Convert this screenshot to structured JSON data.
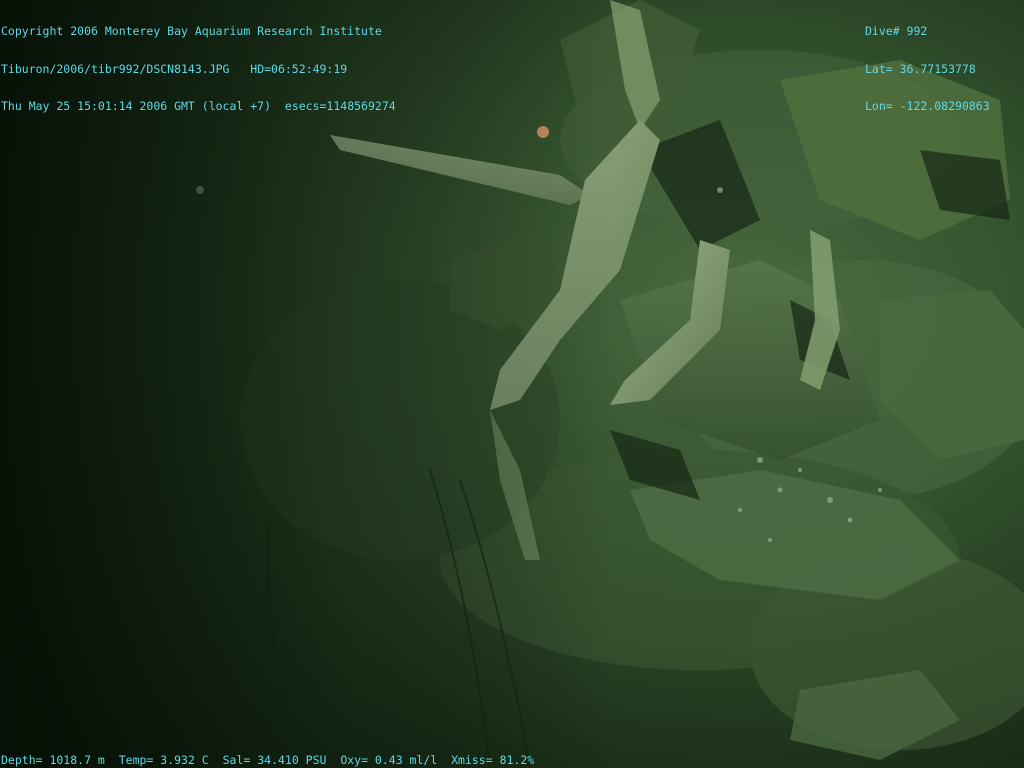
{
  "overlay": {
    "top_left": {
      "copyright": "Copyright 2006 Monterey Bay Aquarium Research Institute",
      "file_path": "Tiburon/2006/tibr992/DSCN8143.JPG",
      "hd_label": "HD=06:52:49:19",
      "datetime": "Thu May 25 15:01:14 2006 GMT (local +7)",
      "esecs": "esecs=1148569274"
    },
    "top_right": {
      "dive": "Dive# 992",
      "lat": "Lat= 36.77153778",
      "lon": "Lon= -122.08290863"
    },
    "bottom": {
      "depth": "Depth= 1018.7 m",
      "temp": "Temp= 3.932 C",
      "salinity": "Sal= 34.410 PSU",
      "oxygen": "Oxy= 0.43 ml/l",
      "xmiss": "Xmiss= 81.2%"
    }
  },
  "colors": {
    "overlay_text": "#5fd8e8",
    "seafloor_dark": "#0f1f10",
    "seafloor_mid": "#2f4a2a",
    "seafloor_light": "#5a7a4e",
    "bone": "#8aa47a"
  }
}
